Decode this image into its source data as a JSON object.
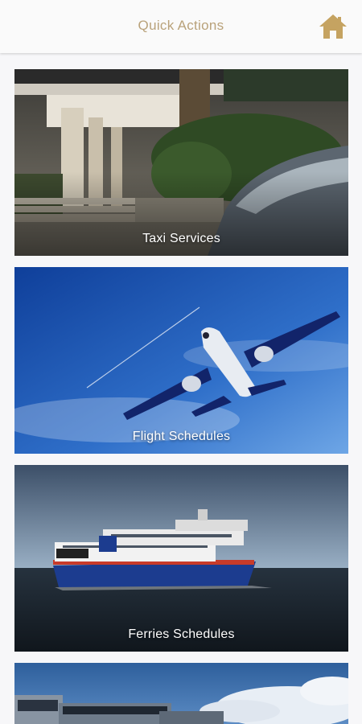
{
  "header": {
    "title": "Quick Actions",
    "home_icon": "home-icon",
    "accent": "#b9a27a",
    "icon_color": "#c5a361"
  },
  "cards": [
    {
      "label": "Taxi Services",
      "image": "hotel-entrance-with-car"
    },
    {
      "label": "Flight Schedules",
      "image": "airplane-in-blue-sky"
    },
    {
      "label": "Ferries Schedules",
      "image": "ferry-at-sea"
    },
    {
      "label": "",
      "image": "buses-under-cloudy-sky"
    }
  ]
}
